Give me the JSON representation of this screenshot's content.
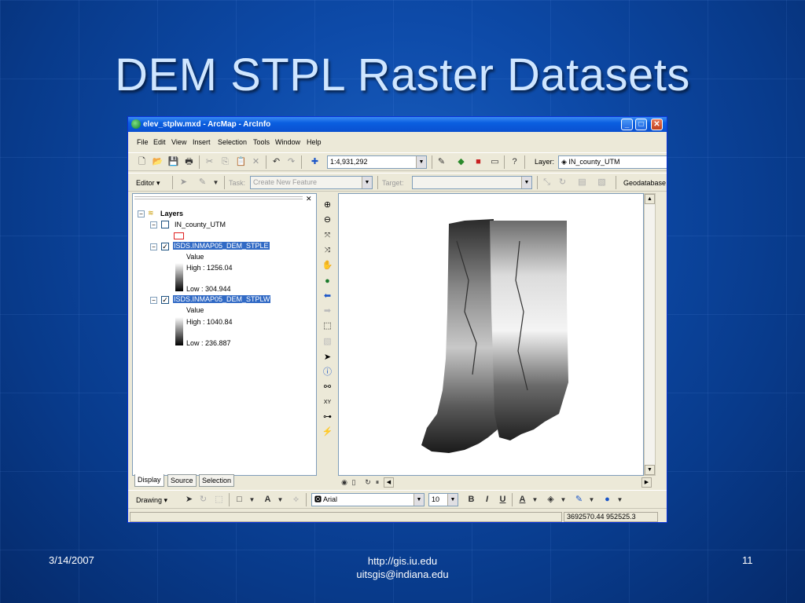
{
  "slide": {
    "title": "DEM STPL Raster Datasets",
    "footer_date": "3/14/2007",
    "footer_url": "http://gis.iu.edu",
    "footer_email": "uitsgis@indiana.edu",
    "page_number": "11"
  },
  "window": {
    "title": "elev_stplw.mxd - ArcMap - ArcInfo",
    "controls": {
      "minimize": "_",
      "maximize": "□",
      "close": "✕"
    }
  },
  "menu": [
    "File",
    "Edit",
    "View",
    "Insert",
    "Selection",
    "Tools",
    "Window",
    "Help"
  ],
  "standard_toolbar": {
    "scale_value": "1:4,931,292",
    "layer_label": "Layer:",
    "layer_value": "IN_county_UTM"
  },
  "editor_toolbar": {
    "editor_label": "Editor",
    "task_label": "Task:",
    "task_value": "Create New Feature",
    "target_label": "Target:",
    "target_value": "",
    "geodatabase_label": "Geodatabase"
  },
  "toc": {
    "root_label": "Layers",
    "layers": [
      {
        "name": "IN_county_UTM",
        "checked": false
      },
      {
        "name": "ISDS.INMAP05_DEM_STPLE",
        "checked": true,
        "value_label": "Value",
        "high": "High : 1256.04",
        "low": "Low : 304.944"
      },
      {
        "name": "ISDS.INMAP05_DEM_STPLW",
        "checked": true,
        "value_label": "Value",
        "high": "High : 1040.84",
        "low": "Low : 236.887"
      }
    ],
    "tabs": [
      "Display",
      "Source",
      "Selection"
    ]
  },
  "drawing_toolbar": {
    "drawing_label": "Drawing",
    "font_value": "Arial",
    "size_value": "10",
    "bold": "B",
    "italic": "I",
    "underline": "U",
    "text_label": "A"
  },
  "status": {
    "coordinates": "3692570.44  952525.3"
  },
  "colors": {
    "slide_background": "#0d4aa8",
    "title_color": "#cfe6ff",
    "titlebar": "#0a5ee0",
    "selection_highlight": "#316ac5"
  }
}
